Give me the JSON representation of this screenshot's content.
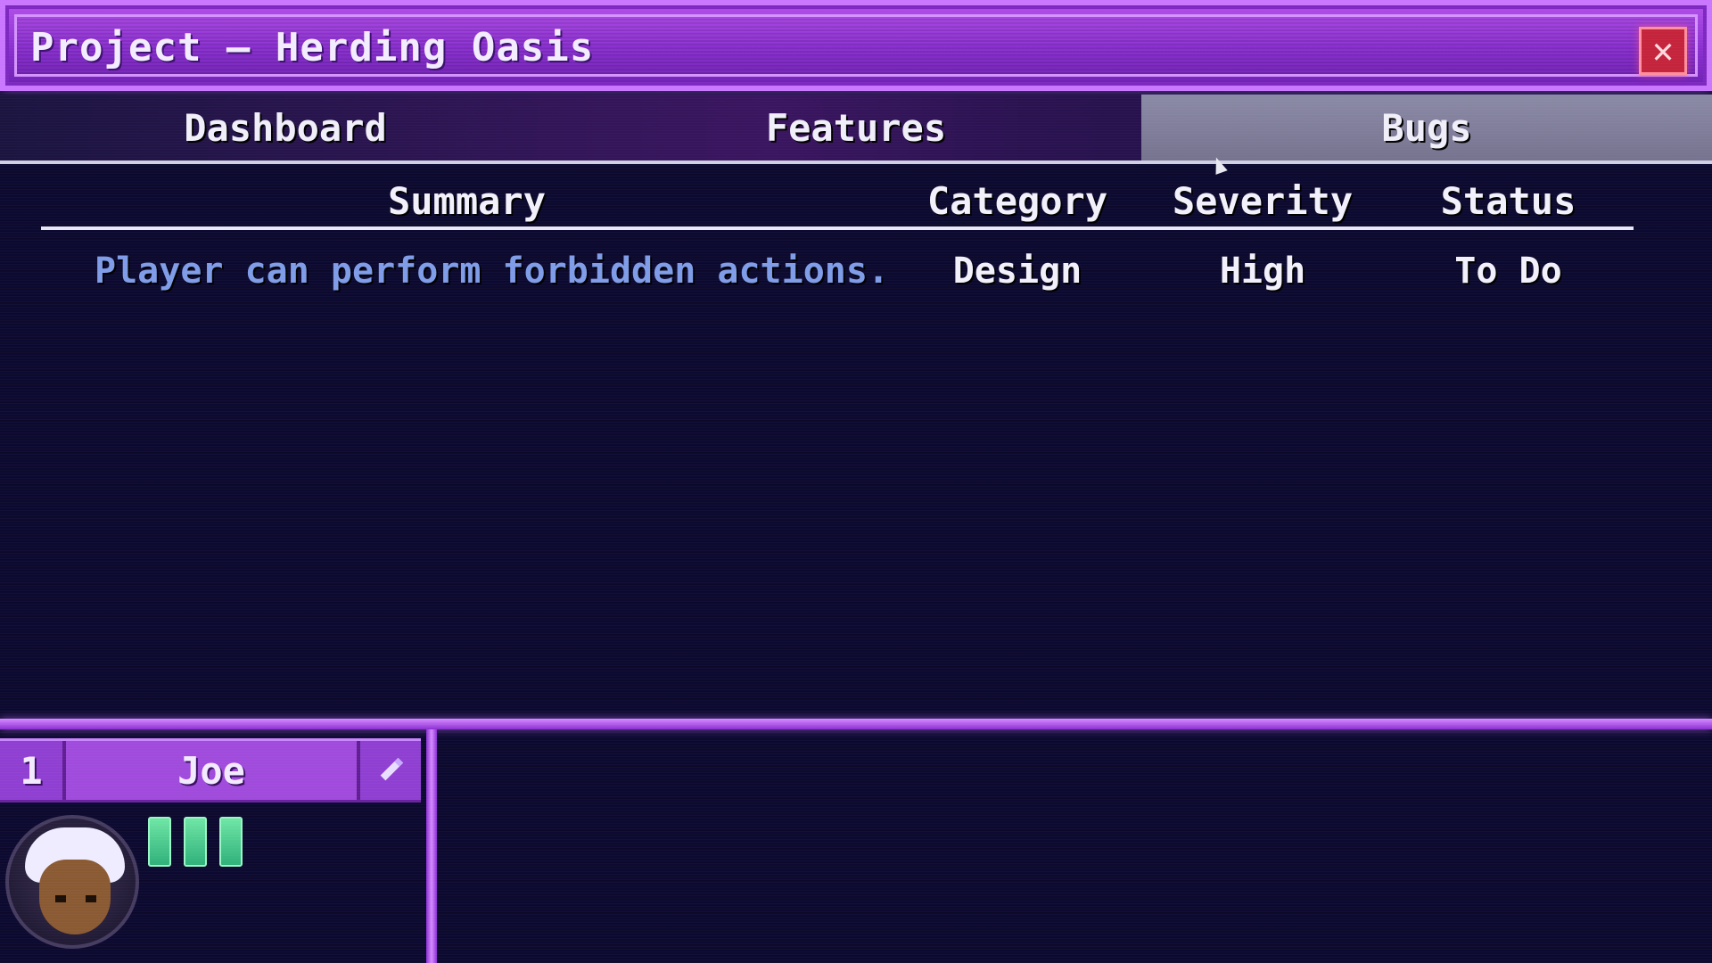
{
  "window": {
    "title": "Project — Herding Oasis",
    "close_glyph": "✕"
  },
  "tabs": [
    {
      "label": "Dashboard",
      "active": false
    },
    {
      "label": "Features",
      "active": false
    },
    {
      "label": "Bugs",
      "active": true
    }
  ],
  "table": {
    "headers": {
      "summary": "Summary",
      "category": "Category",
      "severity": "Severity",
      "status": "Status"
    },
    "rows": [
      {
        "summary": "Player can perform forbidden actions.",
        "category": "Design",
        "severity": "High",
        "status": "To Do"
      }
    ]
  },
  "team": {
    "member": {
      "number": "1",
      "name": "Joe",
      "edit_icon": "pencil-icon",
      "energy_bars": 3
    }
  },
  "colors": {
    "accent_purple": "#9b45dc",
    "summary_link": "#7f9ce8",
    "energy_green": "#4fd08e",
    "close_red": "#c4243c"
  }
}
